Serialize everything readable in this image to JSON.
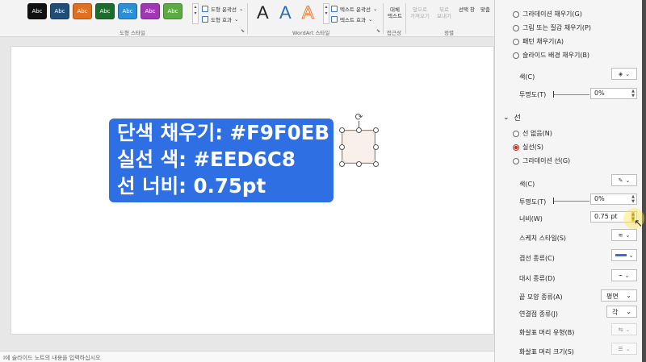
{
  "ribbon": {
    "shape_style_swatches": [
      {
        "label": "Abc",
        "color": "#111111"
      },
      {
        "label": "Abc",
        "color": "#1f4e79"
      },
      {
        "label": "Abc",
        "color": "#e07020"
      },
      {
        "label": "Abc",
        "color": "#1e6b2e"
      },
      {
        "label": "Abc",
        "color": "#2b8fd6"
      },
      {
        "label": "Abc",
        "color": "#a237b5"
      },
      {
        "label": "Abc",
        "color": "#5cab44"
      }
    ],
    "shape_fill_label": "도형 윤곽선",
    "shape_effects_label": "도형 효과",
    "shape_styles_group": "도형 스타일",
    "wordart_letter": "A",
    "text_fill_label": "텍스트 윤곽선",
    "text_effects_label": "텍스트 효과",
    "wordart_group": "WordArt 스타일",
    "alt_text_label": "대체\n텍스트",
    "accessibility_group": "접근성",
    "bring_forward_label": "앞으로\n가져오기",
    "send_backward_label": "뒤로\n보내기",
    "selection_pane_label": "선택 창",
    "align_label": "맞춤",
    "arrange_group": "정렬"
  },
  "slide": {
    "callout_lines": [
      "단색 채우기: #F9F0EB",
      "실선 색: #EED6C8",
      "선 너비: 0.75pt"
    ],
    "shape_fill_color": "#F9F0EB",
    "shape_line_color": "#EED6C8"
  },
  "notes": {
    "placeholder": "I에 슬라이드 노트의 내용을 입력하십시오"
  },
  "pane": {
    "fill_options": [
      "그라데이션 채우기(G)",
      "그림 또는 질감 채우기(P)",
      "패턴 채우기(A)",
      "슬라이드 배경 채우기(B)"
    ],
    "fill_color_label": "색(C)",
    "fill_transparency_label": "투명도(T)",
    "fill_transparency_value": "0%",
    "line_section": "선",
    "line_options": [
      {
        "label": "선 없음(N)",
        "selected": false
      },
      {
        "label": "실선(S)",
        "selected": true
      },
      {
        "label": "그라데이션 선(G)",
        "selected": false
      }
    ],
    "line_color_label": "색(C)",
    "line_transparency_label": "투명도(T)",
    "line_transparency_value": "0%",
    "width_label": "너비(W)",
    "width_value": "0.75 pt",
    "sketch_style_label": "스케치 스타일(S)",
    "compound_type_label": "겹선 종류(C)",
    "dash_type_label": "대시 종류(D)",
    "cap_type_label": "끝 모양 종류(A)",
    "cap_type_value": "평면",
    "join_type_label": "연결점 종류(J)",
    "join_type_value": "각",
    "begin_arrow_type_label": "화살표 머리 유형(B)",
    "begin_arrow_size_label": "화살표 머리 크기(S)"
  }
}
